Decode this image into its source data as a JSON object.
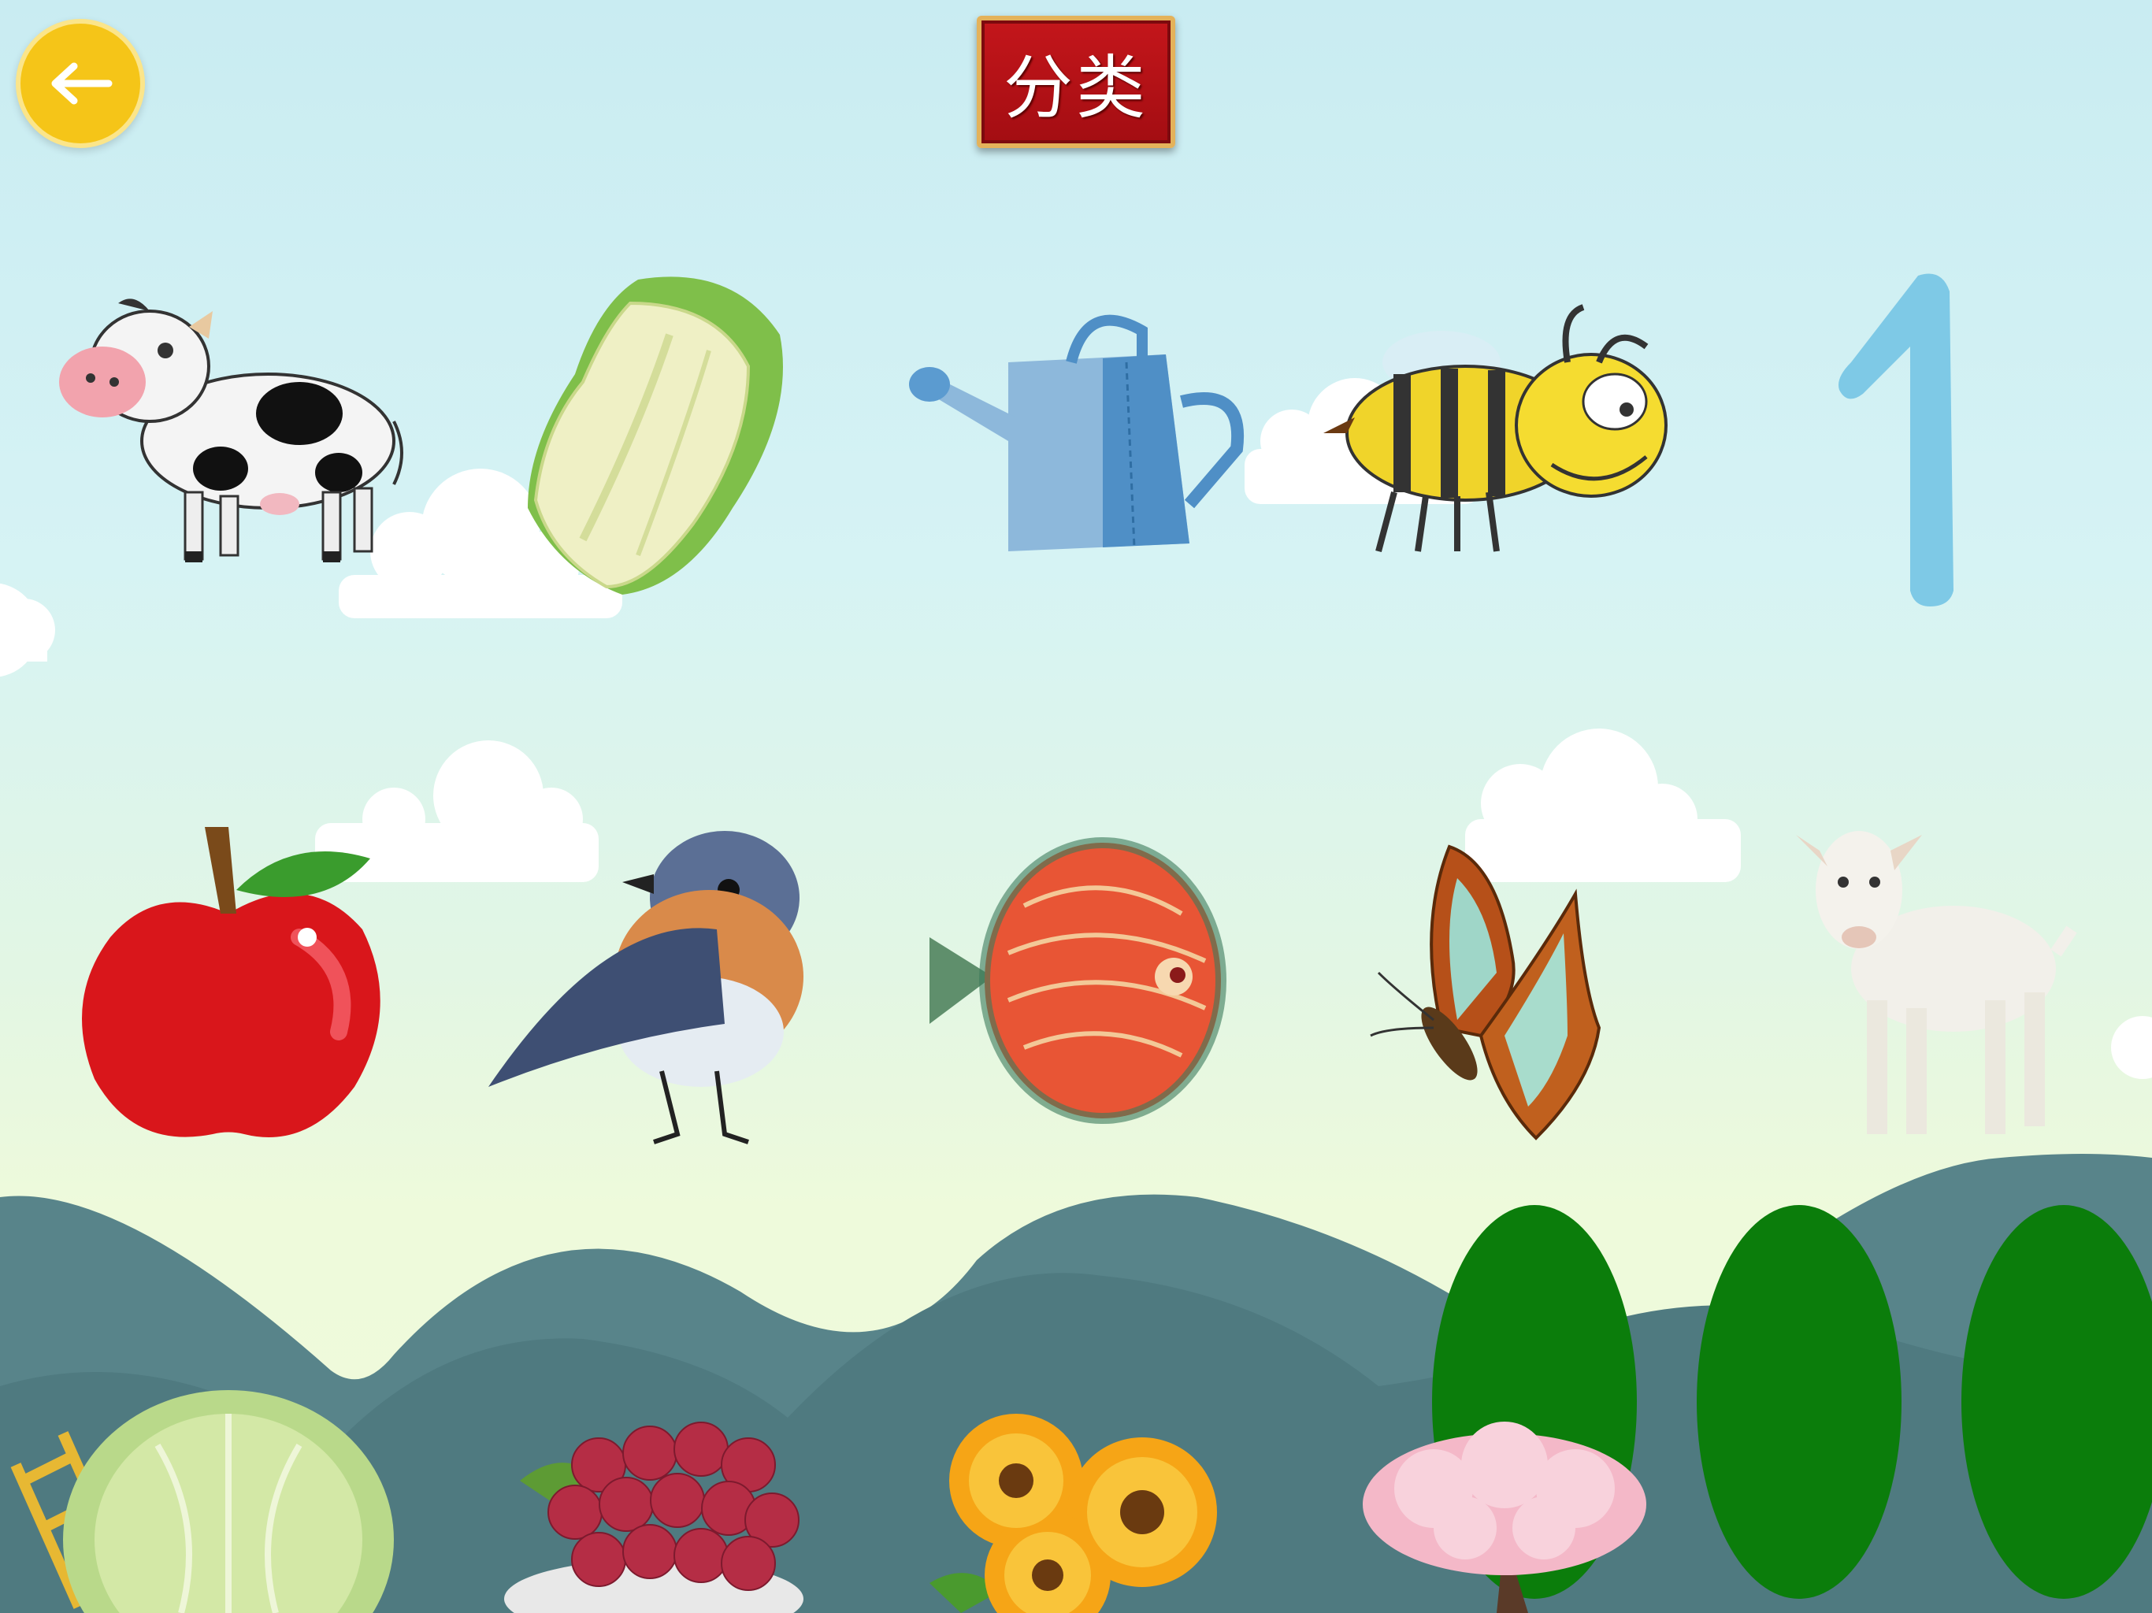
{
  "header": {
    "title": "分类",
    "back_icon": "arrow-left-icon"
  },
  "colors": {
    "back_button": "#f5c518",
    "plaque_red": "#c4161b",
    "plaque_border": "#e4b25a",
    "mountain": "#58848a",
    "tree_green": "#0b7d0b",
    "number_blue": "#7ec9e6"
  },
  "top_row": [
    "cow",
    "chinese-cabbage",
    "watering-can",
    "bee",
    "number-one"
  ],
  "number_item": "1",
  "middle_row": [
    "apple",
    "bird",
    "fish",
    "butterfly",
    "goat"
  ],
  "bottom_row": [
    "cabbage",
    "grapes",
    "flowers",
    "cherry-blossom-tree"
  ]
}
